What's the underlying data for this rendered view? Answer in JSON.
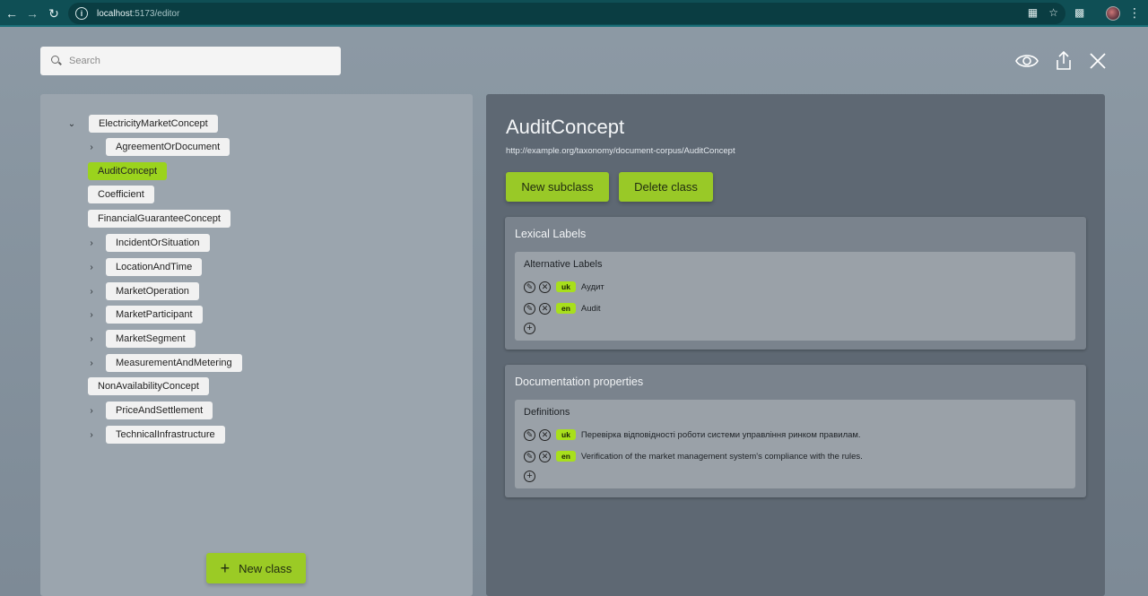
{
  "browser": {
    "url_host": "localhost",
    "url_rest": ":5173/editor"
  },
  "search": {
    "placeholder": "Search"
  },
  "tree": {
    "root": "ElectricityMarketConcept",
    "children": [
      {
        "label": "AgreementOrDocument",
        "expandable": true
      },
      {
        "label": "AuditConcept",
        "expandable": false,
        "selected": true
      },
      {
        "label": "Coefficient",
        "expandable": false
      },
      {
        "label": "FinancialGuaranteeConcept",
        "expandable": false
      },
      {
        "label": "IncidentOrSituation",
        "expandable": true
      },
      {
        "label": "LocationAndTime",
        "expandable": true
      },
      {
        "label": "MarketOperation",
        "expandable": true
      },
      {
        "label": "MarketParticipant",
        "expandable": true
      },
      {
        "label": "MarketSegment",
        "expandable": true
      },
      {
        "label": "MeasurementAndMetering",
        "expandable": true
      },
      {
        "label": "NonAvailabilityConcept",
        "expandable": false
      },
      {
        "label": "PriceAndSettlement",
        "expandable": true
      },
      {
        "label": "TechnicalInfrastructure",
        "expandable": true
      }
    ],
    "new_class_label": "New class"
  },
  "detail": {
    "title": "AuditConcept",
    "uri": "http://example.org/taxonomy/document-corpus/AuditConcept",
    "new_subclass_label": "New subclass",
    "delete_class_label": "Delete class",
    "lexical": {
      "title": "Lexical Labels",
      "alt_title": "Alternative Labels",
      "items": [
        {
          "lang": "uk",
          "text": "Аудит"
        },
        {
          "lang": "en",
          "text": "Audit"
        }
      ]
    },
    "documentation": {
      "title": "Documentation properties",
      "def_title": "Definitions",
      "items": [
        {
          "lang": "uk",
          "text": "Перевірка відповідності роботи системи управління ринком правилам."
        },
        {
          "lang": "en",
          "text": "Verification of the market management system's compliance with the rules."
        }
      ]
    }
  },
  "colors": {
    "accent": "#9bd31d",
    "button_green": "#99c927",
    "browser_bar": "#0f4f55"
  }
}
